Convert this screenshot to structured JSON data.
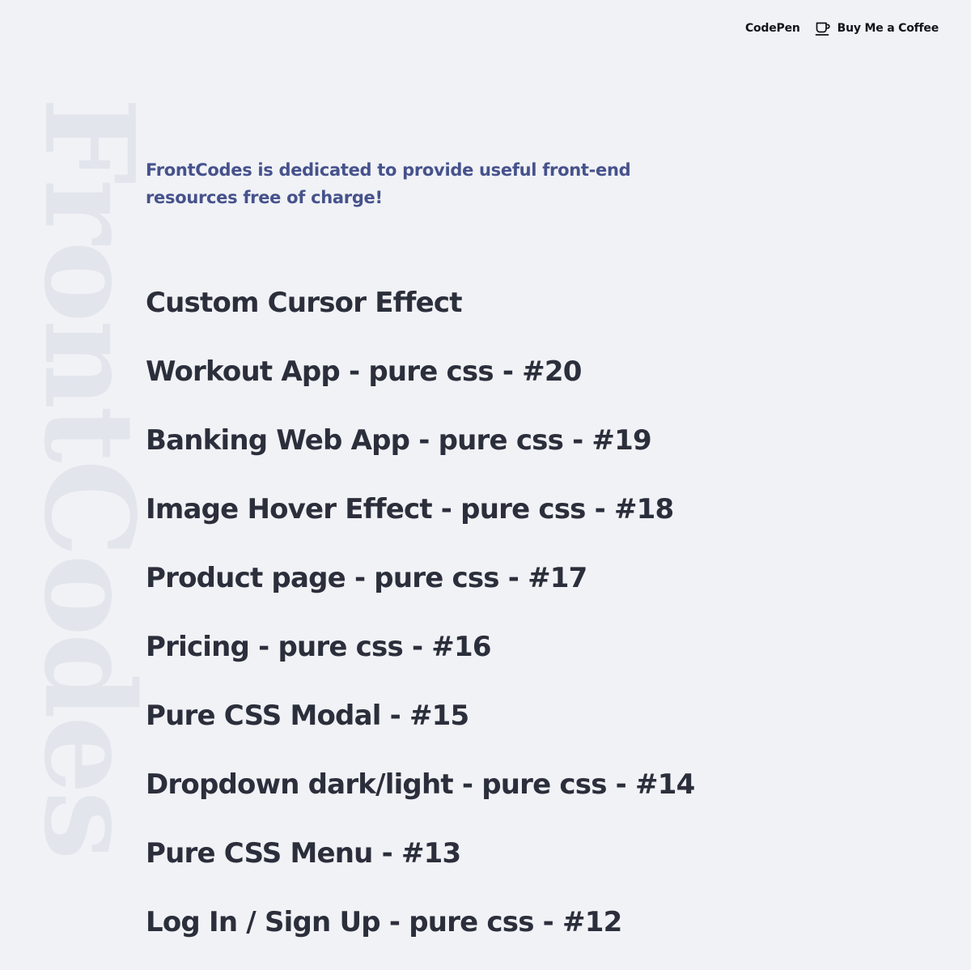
{
  "watermark": {
    "text": "FrontCodes"
  },
  "nav": {
    "codepen_label": "CodePen",
    "coffee_label": "Buy Me a Coffee",
    "coffee_icon": "coffee-cup-icon"
  },
  "tagline": "FrontCodes is dedicated to provide useful front-end resources free of charge!",
  "projects": [
    {
      "title": "Custom Cursor Effect"
    },
    {
      "title": "Workout App - pure css - #20"
    },
    {
      "title": "Banking Web App - pure css - #19"
    },
    {
      "title": "Image Hover Effect - pure css - #18"
    },
    {
      "title": "Product page - pure css - #17"
    },
    {
      "title": "Pricing - pure css - #16"
    },
    {
      "title": "Pure CSS Modal - #15"
    },
    {
      "title": "Dropdown dark/light - pure css - #14"
    },
    {
      "title": "Pure CSS Menu - #13"
    },
    {
      "title": "Log In / Sign Up - pure css - #12"
    }
  ],
  "colors": {
    "background": "#f1f2f6",
    "watermark": "#e3e5ed",
    "tagline": "#46528c",
    "project_text": "#2b2f3b",
    "nav_text": "#11131a"
  }
}
